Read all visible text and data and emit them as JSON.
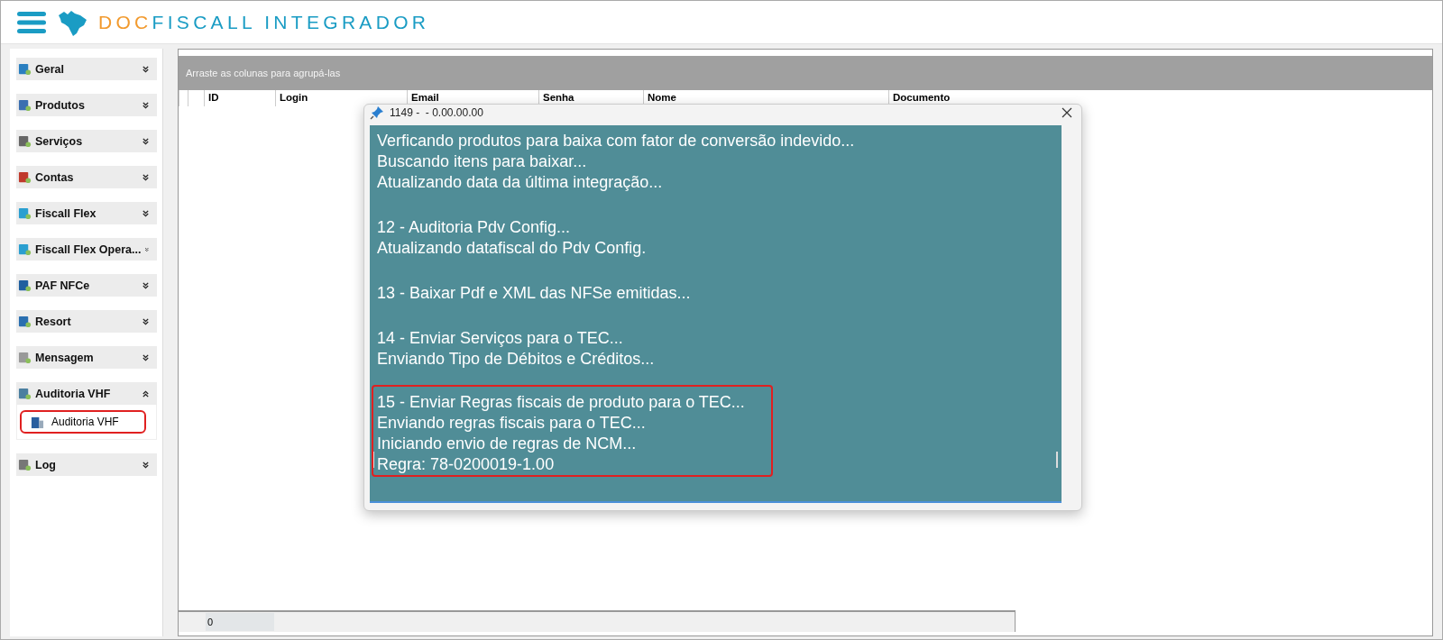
{
  "header": {
    "brand_prefix": "DOC",
    "brand_name": "FISCALL INTEGRADOR"
  },
  "sidebar": {
    "items": [
      {
        "label": "Geral",
        "expanded": false
      },
      {
        "label": "Produtos",
        "expanded": false
      },
      {
        "label": "Serviços",
        "expanded": false
      },
      {
        "label": "Contas",
        "expanded": false
      },
      {
        "label": "Fiscall Flex",
        "expanded": false
      },
      {
        "label": "Fiscall Flex Opera...",
        "expanded": false
      },
      {
        "label": "PAF NFCe",
        "expanded": false
      },
      {
        "label": "Resort",
        "expanded": false
      },
      {
        "label": "Mensagem",
        "expanded": false
      },
      {
        "label": "Auditoria VHF",
        "expanded": true,
        "children": [
          {
            "label": "Auditoria VHF",
            "highlighted": true
          }
        ]
      },
      {
        "label": "Log",
        "expanded": false
      }
    ]
  },
  "grid": {
    "group_hint": "Arraste as colunas para agrupá-las",
    "columns": [
      "ID",
      "Login",
      "Email",
      "Senha",
      "Nome",
      "Documento"
    ],
    "footer": {
      "count": "0"
    }
  },
  "dialog": {
    "title": "1149 -  - 0.00.00.00",
    "log_blocks": [
      {
        "highlighted": false,
        "lines": [
          "Verficando produtos para baixa com fator de conversão indevido...",
          "Buscando itens para baixar...",
          "Atualizando data da última integração..."
        ]
      },
      {
        "highlighted": false,
        "lines": [
          "12 - Auditoria Pdv Config...",
          "Atualizando datafiscal do Pdv Config."
        ]
      },
      {
        "highlighted": false,
        "lines": [
          "13 - Baixar Pdf e XML das NFSe emitidas..."
        ]
      },
      {
        "highlighted": false,
        "lines": [
          "14 - Enviar Serviços para o TEC...",
          "Enviando Tipo de Débitos e Créditos..."
        ]
      },
      {
        "highlighted": true,
        "lines": [
          "15 - Enviar Regras fiscais de produto para o TEC...",
          "Enviando regras fiscais para o TEC...",
          "Iniciando envio de regras de NCM...",
          "Regra: 78-0200019-1.00"
        ]
      }
    ]
  }
}
